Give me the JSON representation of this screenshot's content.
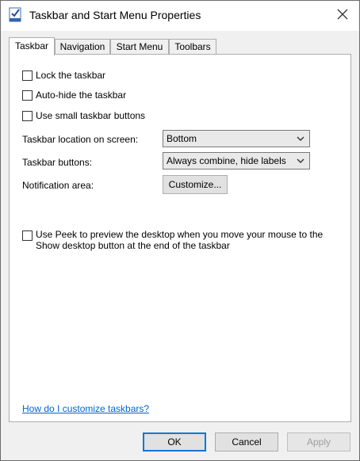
{
  "window": {
    "title": "Taskbar and Start Menu Properties"
  },
  "tabs": [
    {
      "label": "Taskbar",
      "active": true
    },
    {
      "label": "Navigation",
      "active": false
    },
    {
      "label": "Start Menu",
      "active": false
    },
    {
      "label": "Toolbars",
      "active": false
    }
  ],
  "taskbar": {
    "lock_label": "Lock the taskbar",
    "lock_checked": false,
    "autohide_label": "Auto-hide the taskbar",
    "autohide_checked": false,
    "small_buttons_label": "Use small taskbar buttons",
    "small_buttons_checked": false,
    "location_label": "Taskbar location on screen:",
    "location_value": "Bottom",
    "buttons_label": "Taskbar buttons:",
    "buttons_value": "Always combine, hide labels",
    "notification_label": "Notification area:",
    "customize_label": "Customize...",
    "peek_label": "Use Peek to preview the desktop when you move your mouse to the Show desktop button at the end of the taskbar",
    "peek_checked": false,
    "help_link": "How do I customize taskbars?"
  },
  "footer": {
    "ok_label": "OK",
    "cancel_label": "Cancel",
    "apply_label": "Apply"
  },
  "colors": {
    "link": "#0066cc",
    "default_button_border": "#0078d7",
    "disabled_text": "#a0a0a0"
  },
  "icons": [
    "taskbar-properties-icon",
    "close-icon",
    "chevron-down-icon"
  ]
}
